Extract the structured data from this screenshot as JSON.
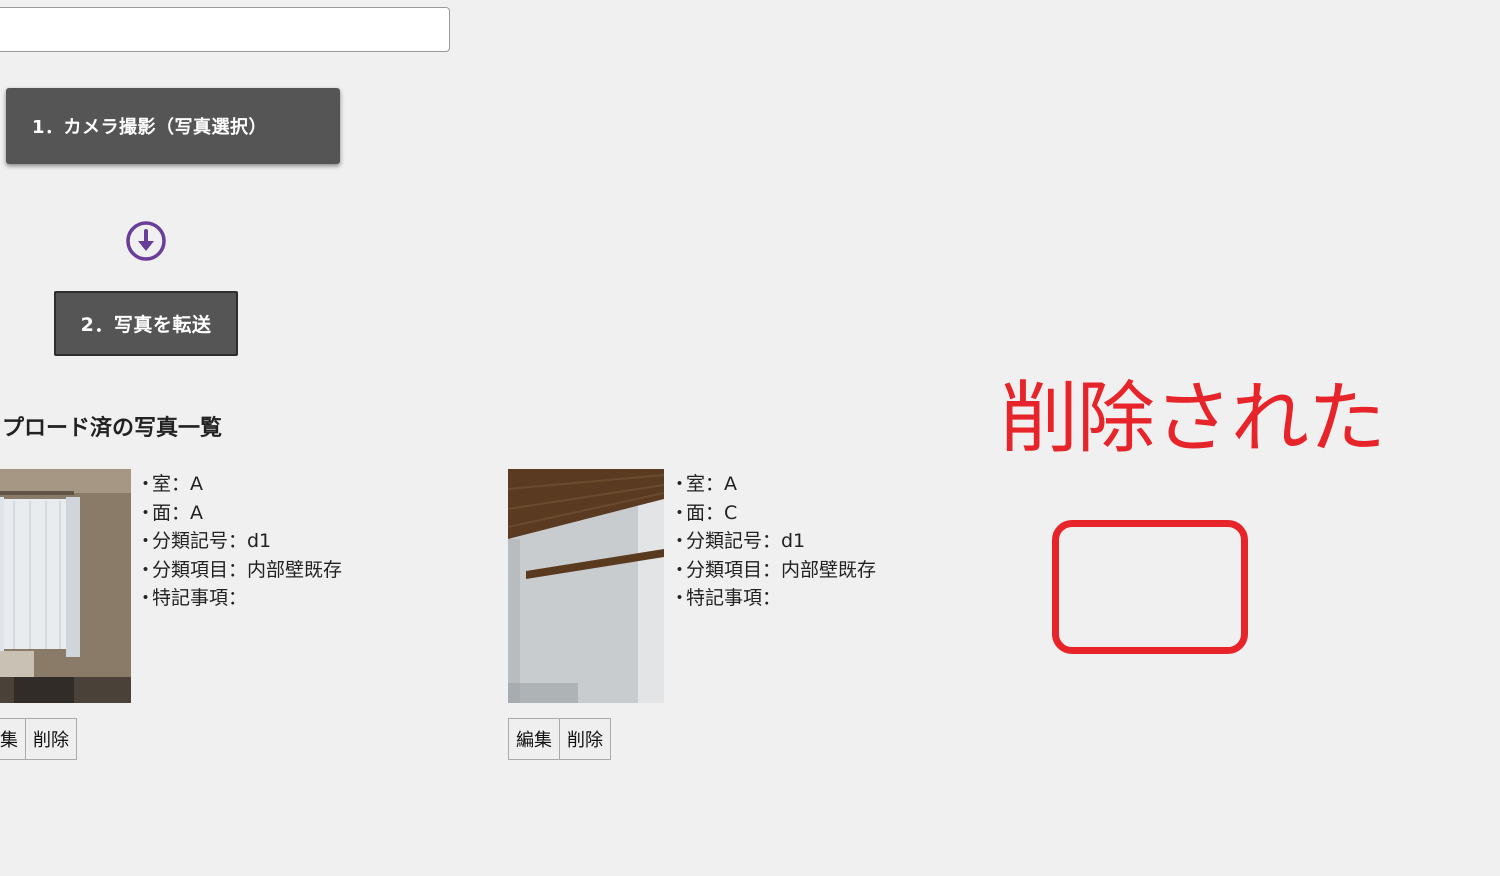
{
  "input": {
    "value": "",
    "placeholder": ""
  },
  "buttons": {
    "camera_label": "1．カメラ撮影（写真選択）",
    "transfer_label": "2．写真を転送"
  },
  "icons": {
    "arrow": "arrow-down-circle-icon",
    "arrow_color": "#6a3d9a"
  },
  "section": {
    "title": "アップロード済の写真一覧"
  },
  "photos": [
    {
      "room": "室：A",
      "face": "面：A",
      "code": "分類記号：d1",
      "item": "分類項目：内部壁既存",
      "note": "特記事項：",
      "edit_label": "編集",
      "delete_label": "削除"
    },
    {
      "room": "室：A",
      "face": "面：C",
      "code": "分類記号：d1",
      "item": "分類項目：内部壁既存",
      "note": "特記事項：",
      "edit_label": "編集",
      "delete_label": "削除"
    }
  ],
  "annotation": {
    "text": "削除された",
    "color": "#e8242b"
  },
  "colors": {
    "background": "#f0f0f0",
    "button_dark": "#555555"
  }
}
